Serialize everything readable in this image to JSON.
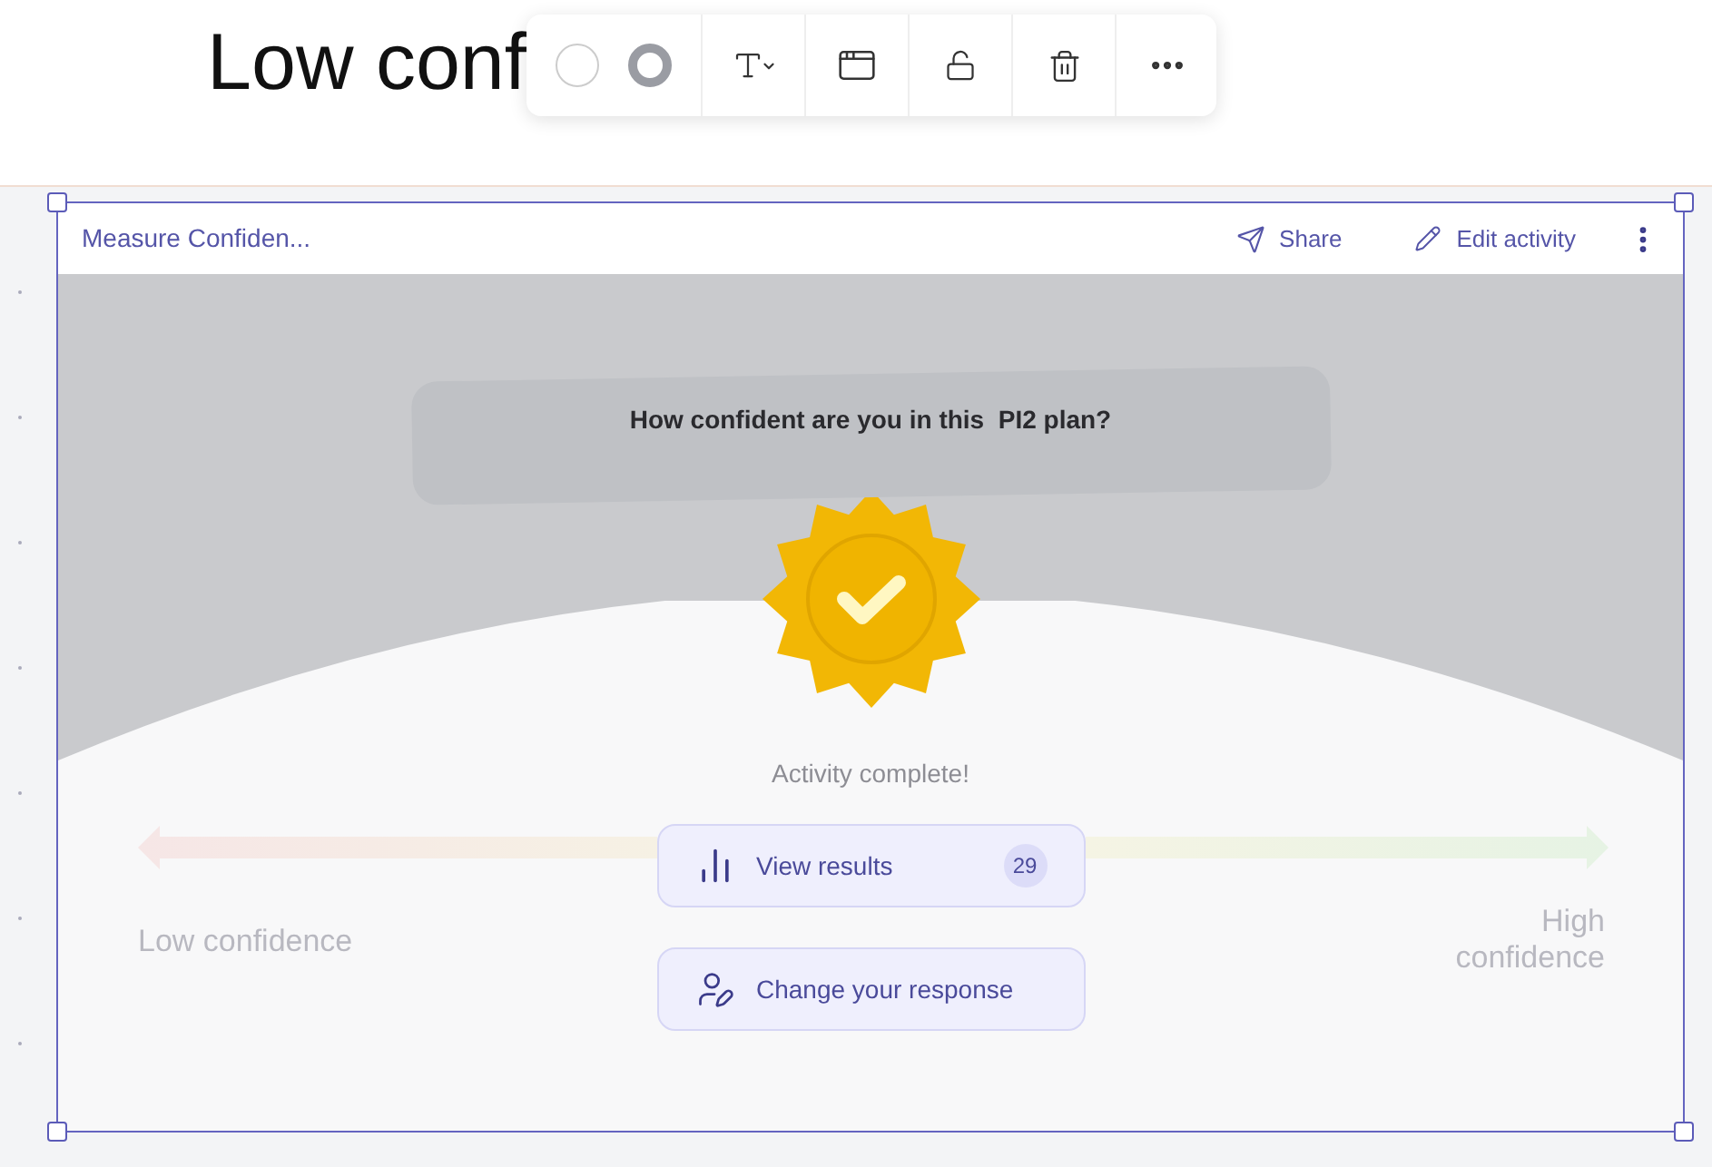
{
  "canvas_heading": "Low conf",
  "activity": {
    "title": "Measure Confiden...",
    "actions": [
      {
        "kind": "share",
        "label": "Share"
      },
      {
        "kind": "edit",
        "label": "Edit activity"
      }
    ],
    "question": "How confident are you in this  PI2 plan?",
    "status": "Activity complete!",
    "scale": {
      "low_label": "Low confidence",
      "high_label": "High confidence"
    },
    "buttons": [
      {
        "kind": "results",
        "label": "View results",
        "count": "29"
      },
      {
        "kind": "change",
        "label": "Change your response"
      }
    ]
  }
}
